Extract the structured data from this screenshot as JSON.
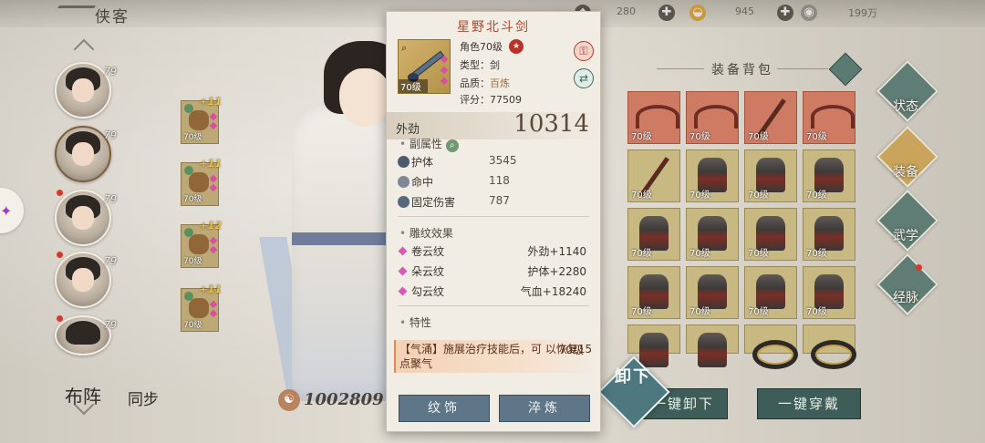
{
  "header": {
    "title": "侠客",
    "currencies": [
      {
        "value": "280",
        "icon": "jade-icon"
      },
      {
        "value": "945",
        "icon": "gold-ingot-icon"
      },
      {
        "value": "199万",
        "icon": "coin-icon"
      }
    ]
  },
  "roster": {
    "characters": [
      {
        "level": "79"
      },
      {
        "level": "79"
      },
      {
        "level": "79"
      },
      {
        "level": "79"
      },
      {
        "level": "79"
      }
    ],
    "bottom_buttons": {
      "formation": "布阵",
      "sync": "同步"
    }
  },
  "equipped": [
    {
      "level": "70级",
      "enhance": "+11"
    },
    {
      "level": "70级",
      "enhance": "+11"
    },
    {
      "level": "70级",
      "enhance": "+12"
    },
    {
      "level": "70级",
      "enhance": "+11"
    }
  ],
  "character": {
    "combat_power": "1002809"
  },
  "tooltip": {
    "name": "星野北斗剑",
    "icon_level": "70级",
    "role_level": "角色70级",
    "type": "类型：剑",
    "quality_label": "品质：",
    "quality": "百炼",
    "score": "评分：77509",
    "main_stat": {
      "label": "外劲",
      "value": "10314"
    },
    "sub_title": "副属性",
    "sub_stats": [
      {
        "name": "护体",
        "value": "3545"
      },
      {
        "name": "命中",
        "value": "118"
      },
      {
        "name": "固定伤害",
        "value": "787"
      }
    ],
    "engrave_title": "雕纹效果",
    "engravings": [
      {
        "name": "卷云纹",
        "stat": "外劲",
        "bonus": "+1140"
      },
      {
        "name": "朵云纹",
        "stat": "护体",
        "bonus": "+2280"
      },
      {
        "name": "勾云纹",
        "stat": "气血",
        "bonus": "+18240"
      }
    ],
    "trait_title": "特性",
    "trait_text": "【气涌】施展治疗技能后，可 以恢复15点聚气",
    "trait_level": "70级",
    "buttons": {
      "decorate": "纹饰",
      "refine": "淬炼"
    }
  },
  "bag": {
    "title": "装备背包",
    "rows": [
      [
        {
          "type": "claw",
          "color": "red",
          "level": "70级"
        },
        {
          "type": "claw",
          "color": "red",
          "level": "70级"
        },
        {
          "type": "spear",
          "color": "red",
          "level": "70级"
        },
        {
          "type": "claw",
          "color": "red",
          "level": "70级"
        }
      ],
      [
        {
          "type": "spear",
          "color": "gold",
          "level": "70级"
        },
        {
          "type": "armor",
          "color": "gold",
          "level": "70级"
        },
        {
          "type": "armor",
          "color": "gold",
          "level": "70级"
        },
        {
          "type": "armor",
          "color": "gold",
          "level": "70级"
        }
      ],
      [
        {
          "type": "armor",
          "color": "gold",
          "level": "70级"
        },
        {
          "type": "armor",
          "color": "gold",
          "level": "70级"
        },
        {
          "type": "armor",
          "color": "gold",
          "level": "70级"
        },
        {
          "type": "armor",
          "color": "gold",
          "level": "70级"
        }
      ],
      [
        {
          "type": "armor",
          "color": "gold",
          "level": "70级"
        },
        {
          "type": "armor",
          "color": "gold",
          "level": "70级"
        },
        {
          "type": "armor",
          "color": "gold",
          "level": "70级"
        },
        {
          "type": "armor",
          "color": "gold",
          "level": "70级"
        }
      ],
      [
        {
          "type": "armor",
          "color": "gold",
          "level": ""
        },
        {
          "type": "armor",
          "color": "gold",
          "level": ""
        },
        {
          "type": "ring",
          "color": "gold",
          "level": ""
        },
        {
          "type": "ring",
          "color": "gold",
          "level": ""
        }
      ]
    ],
    "unequip_label": "卸下",
    "unequip_all": "一键卸下",
    "equip_all": "一键穿戴"
  },
  "side_nav": [
    {
      "label": "状态",
      "active": false
    },
    {
      "label": "装备",
      "active": true
    },
    {
      "label": "武学",
      "active": false
    },
    {
      "label": "经脉",
      "active": false
    }
  ],
  "colors": {
    "accent_red": "#b04a2c",
    "quality_orange": "#b06a2a",
    "button_teal": "#3e5c58",
    "gem_pink": "#d94fa0"
  }
}
